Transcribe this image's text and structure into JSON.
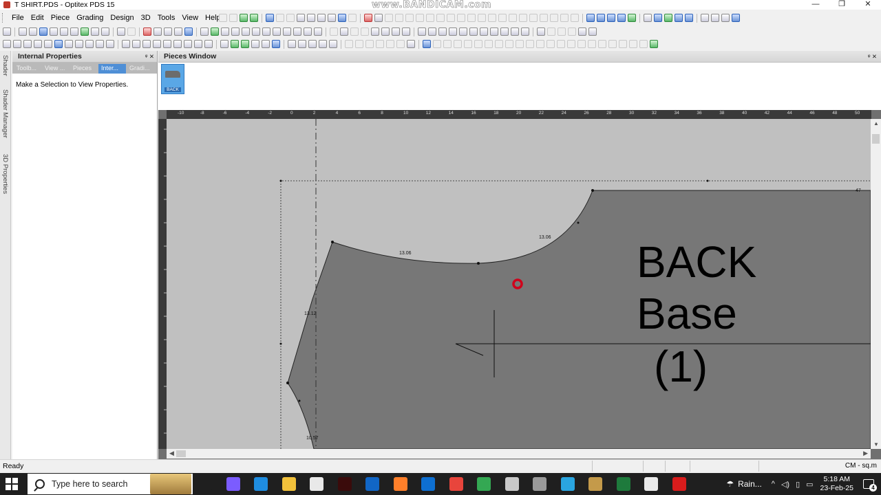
{
  "window": {
    "title": "T SHIRT.PDS - Optitex PDS 15",
    "watermark": "www.BANDICAM.com",
    "minimize": "—",
    "restore": "❐",
    "close": "✕"
  },
  "menu": [
    "File",
    "Edit",
    "Piece",
    "Grading",
    "Design",
    "3D",
    "Tools",
    "View",
    "Help"
  ],
  "side_tabs": [
    "Shader",
    "Shader Manager",
    "3D Properties"
  ],
  "internal_properties": {
    "title": "Internal Properties",
    "pin": "ᵠ ✕",
    "tabs": [
      "Toolb...",
      "View ...",
      "Pieces",
      "Inter...",
      "Gradi..."
    ],
    "active_tab": "Inter...",
    "message": "Make a Selection to View Properties."
  },
  "pieces_window": {
    "title": "Pieces Window",
    "pin": "ᵠ ✕",
    "thumbnail_label": "BACK"
  },
  "ruler_top": [
    "-10",
    "-8",
    "-6",
    "-4",
    "-2",
    "0",
    "2",
    "4",
    "6",
    "8",
    "10",
    "12",
    "14",
    "16",
    "18",
    "20",
    "22",
    "24",
    "26",
    "28",
    "30",
    "32",
    "34",
    "36",
    "38",
    "40",
    "42",
    "44",
    "46",
    "48",
    "50"
  ],
  "piece": {
    "name_line1": "BACK",
    "name_line2": "Base",
    "name_line3": "(1)",
    "measure_shoulder": "13.06",
    "measure_neck": "13.06",
    "measure_armhole": "13.12",
    "measure_side": "10.57",
    "measure_corner": "47",
    "fill_color": "#777777",
    "background_color": "#c0c0c0",
    "cursor_marker_color": "#d0021b"
  },
  "status": {
    "text": "Ready",
    "units": "CM - sq.m"
  },
  "taskbar": {
    "search_placeholder": "Type here to search",
    "weather": "Rain...",
    "time": "5:18 AM",
    "date": "23-Feb-25",
    "notifications": "4",
    "apps": [
      {
        "name": "task-view",
        "color": "#1f1f1f"
      },
      {
        "name": "copilot",
        "color": "#7b5cff"
      },
      {
        "name": "edge",
        "color": "#1f8de0"
      },
      {
        "name": "file-explorer",
        "color": "#f2c13b"
      },
      {
        "name": "store",
        "color": "#e9e9e9"
      },
      {
        "name": "illustrator",
        "color": "#3a0b0b"
      },
      {
        "name": "outlook",
        "color": "#1166c6"
      },
      {
        "name": "firefox",
        "color": "#ff7f2a"
      },
      {
        "name": "teamviewer",
        "color": "#0e6fd1"
      },
      {
        "name": "chrome",
        "color": "#e8453c"
      },
      {
        "name": "chrome-2",
        "color": "#34a853"
      },
      {
        "name": "paint",
        "color": "#c9c9c9"
      },
      {
        "name": "keyboard",
        "color": "#9a9a9a"
      },
      {
        "name": "photos",
        "color": "#2aa5e0"
      },
      {
        "name": "optitex",
        "color": "#c49a4a"
      },
      {
        "name": "excel",
        "color": "#1e7a3c"
      },
      {
        "name": "security",
        "color": "#e9e9e9"
      },
      {
        "name": "bandicam",
        "color": "#d81c1c"
      }
    ]
  }
}
